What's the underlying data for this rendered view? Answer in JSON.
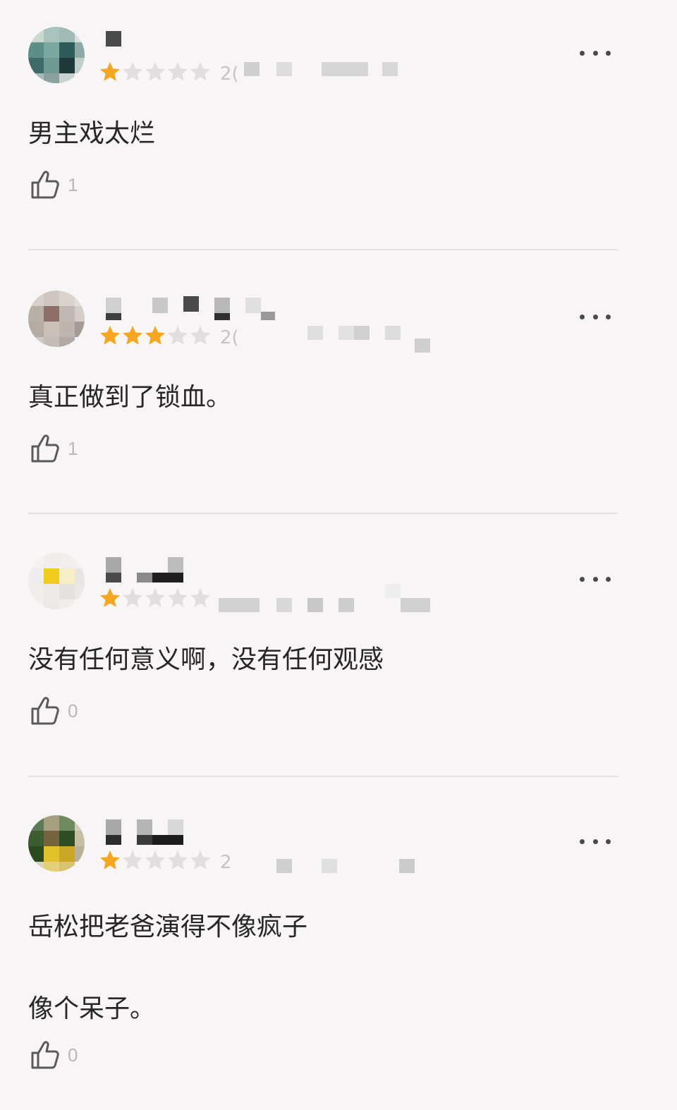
{
  "reviews": [
    {
      "rating": 1,
      "max_rating": 5,
      "date_visible_prefix": "2(",
      "content": "男主戏太烂",
      "likes": "1",
      "more_icon": "more-horizontal-icon",
      "like_icon": "thumbs-up-icon"
    },
    {
      "rating": 3,
      "max_rating": 5,
      "date_visible_prefix": "2(",
      "content": "真正做到了锁血。",
      "likes": "1",
      "more_icon": "more-horizontal-icon",
      "like_icon": "thumbs-up-icon"
    },
    {
      "rating": 1,
      "max_rating": 5,
      "date_visible_prefix": "",
      "content": "没有任何意义啊，没有任何观感",
      "likes": "0",
      "more_icon": "more-horizontal-icon",
      "like_icon": "thumbs-up-icon"
    },
    {
      "rating": 1,
      "max_rating": 5,
      "date_visible_prefix": "2",
      "content": "岳松把老爸演得不像疯子\n\n像个呆子。",
      "likes": "0",
      "more_icon": "more-horizontal-icon",
      "like_icon": "thumbs-up-icon"
    }
  ],
  "colors": {
    "background": "#f7f5f5",
    "star_filled": "#f5a623",
    "star_empty": "#e0dede",
    "text": "#262626",
    "muted": "#b8b8b8",
    "divider": "#e4e1e1"
  }
}
